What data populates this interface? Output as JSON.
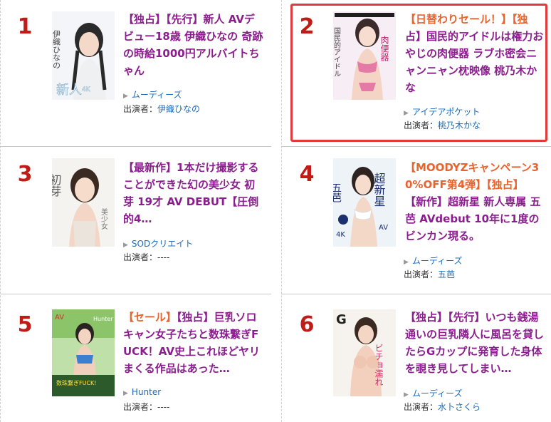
{
  "cast_prefix": "出演者：",
  "items": [
    {
      "rank": "1",
      "title_parts": [
        "【独占】【先行】新人 AVデビュー18歳 伊織ひなの 奇跡の時給1000円アルバイトちゃん"
      ],
      "title_lines": [
        "【独占】【先行】新人 AVデ",
        "ビュー18歳 伊織ひなの 奇跡",
        "の時給1000円アルバイトち",
        "ゃん"
      ],
      "maker": "ムーディーズ",
      "cast": "伊織ひなの",
      "cover_text": "伊織ひなの 新人 4K"
    },
    {
      "rank": "2",
      "title_lines": [
        "【日替わりセール！】【独",
        "占】国民的アイドルは権力お",
        "やじの肉便器 ラブホ密会ニ",
        "ャンニャン枕映像 桃乃木か",
        "な"
      ],
      "maker": "アイデアポケット",
      "cast": "桃乃木かな",
      "cover_text": "国民的アイドル 肉便器"
    },
    {
      "rank": "3",
      "title_lines": [
        "【最新作】1本だけ撮影する",
        "ことができた幻の美少女 初",
        "芽 19才 AV DEBUT【圧倒",
        "的4…"
      ],
      "maker": "SODクリエイト",
      "cast": "----",
      "cover_text": "初芽 美少女"
    },
    {
      "rank": "4",
      "title_lines": [
        "【MOODYZキャンペーン3",
        "0%OFF第4弾】【独占】",
        "【新作】超新星 新人専属 五",
        "芭 AVdebut 10年に1度の",
        "ビンカン現る。"
      ],
      "maker": "ムーディーズ",
      "cast": "五芭",
      "cover_text": "超新星 AV debut 五芭 4K"
    },
    {
      "rank": "5",
      "title_lines": [
        "【セール】【独占】巨乳ソロ",
        "キャン女子たちと数珠繋ぎF",
        "UCK！AV史上これほどヤリ",
        "まくる作品はあった…"
      ],
      "maker": "Hunter",
      "cast": "----",
      "cover_text": "Hunter 数珠繋ぎFUCK!"
    },
    {
      "rank": "6",
      "title_lines": [
        "【独占】【先行】いつも銭湯",
        "通いの巨乳隣人に風呂を貸し",
        "たらGカップに発育した身体",
        "を覗き見してしまい…"
      ],
      "maker": "ムーディーズ",
      "cast": "水卜さくら",
      "cover_text": "G ビチョ濡れ"
    }
  ],
  "colors": {
    "rank": "#c11b17",
    "title": "#8b1d8e",
    "tag": "#e8632d",
    "link": "#1e6bb8",
    "highlight_border": "#e03a3a"
  },
  "icons": {
    "maker_arrow": "triangle-right-icon"
  }
}
